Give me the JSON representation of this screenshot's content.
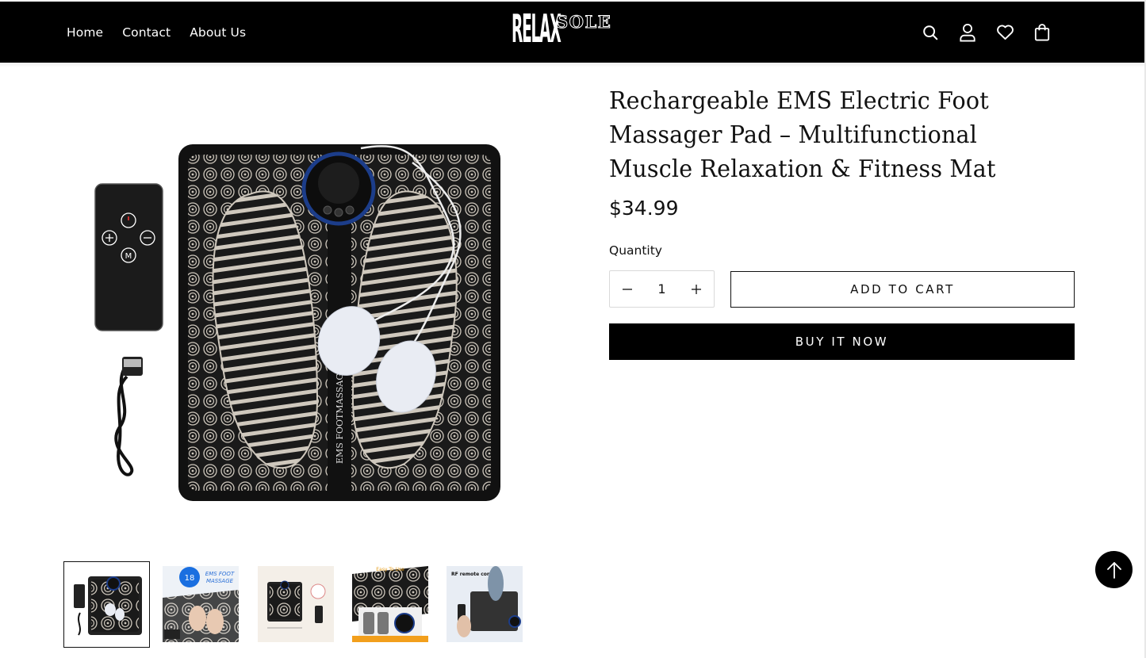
{
  "header": {
    "nav": [
      {
        "label": "Home"
      },
      {
        "label": "Contact"
      },
      {
        "label": "About Us"
      }
    ],
    "logo": {
      "part1": "RELAX",
      "part2": "SOLE"
    },
    "icons": [
      "search-icon",
      "account-icon",
      "wishlist-heart-icon",
      "cart-bag-icon"
    ]
  },
  "product": {
    "title": "Rechargeable EMS Electric Foot Massager Pad – Multifunctional Muscle Relaxation & Fitness Mat",
    "price": "$34.99",
    "quantity_label": "Quantity",
    "quantity_value": "1",
    "add_to_cart": "ADD TO CART",
    "buy_now": "BUY IT NOW"
  },
  "gallery": {
    "main_image_label": "EMS FOOTMASSAGER",
    "thumbnails": [
      {
        "name": "thumb-mat-with-remote",
        "selected": true
      },
      {
        "name": "thumb-feet-on-mat",
        "selected": false,
        "caption": "EMS FOOT MASSAGE"
      },
      {
        "name": "thumb-dimensions",
        "selected": false
      },
      {
        "name": "thumb-easy-to-use",
        "selected": false,
        "caption": "Easy To Use"
      },
      {
        "name": "thumb-rf-remote",
        "selected": false,
        "caption": "RF remote control"
      }
    ]
  },
  "colors": {
    "header_bg": "#000000",
    "accent": "#000000",
    "page_bg": "#ffffff"
  }
}
